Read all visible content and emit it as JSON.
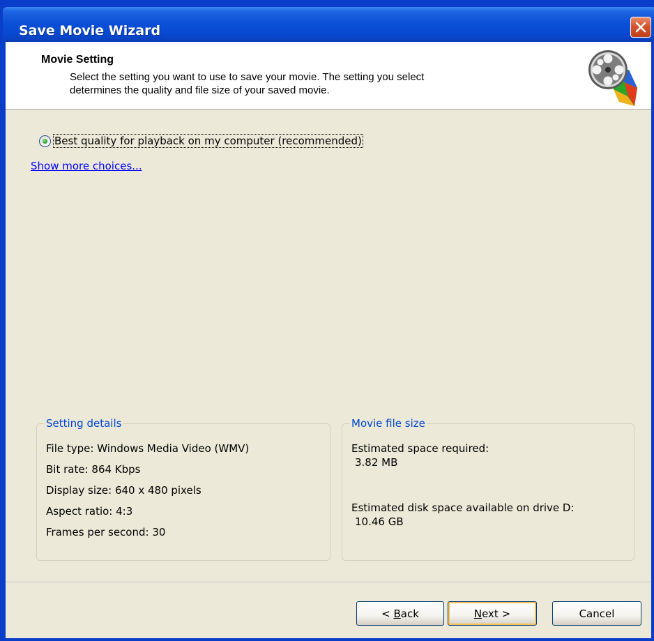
{
  "window": {
    "title": "Save Movie Wizard",
    "close_label": "×"
  },
  "header": {
    "title": "Movie Setting",
    "description_line1": "Select the setting you want to use to save your movie. The setting you select",
    "description_line2": "determines the quality and file size of your saved movie.",
    "icon": "film-reel-icon"
  },
  "options": {
    "selected_label": "Best quality for playback on my computer (recommended)",
    "more_choices_link": "Show more choices..."
  },
  "setting_details": {
    "legend": "Setting details",
    "lines": [
      "File type: Windows Media Video (WMV)",
      "Bit rate: 864 Kbps",
      "Display size: 640 x 480 pixels",
      "Aspect ratio: 4:3",
      "Frames per second: 30"
    ]
  },
  "file_size": {
    "legend": "Movie file size",
    "space_required_label": "Estimated space required:",
    "space_required_value": "3.82 MB",
    "disk_available_label": "Estimated disk space available on drive D:",
    "disk_available_value": "10.46 GB"
  },
  "buttons": {
    "back_prefix": "< ",
    "back_hotkey": "B",
    "back_rest": "ack",
    "next_hotkey": "N",
    "next_rest": "ext >",
    "cancel": "Cancel"
  },
  "colors": {
    "titlebar": "#0a50d8",
    "client_bg": "#ece9d8",
    "legend_text": "#0046d5",
    "link": "#0000ff",
    "close_button": "#d7532d"
  }
}
